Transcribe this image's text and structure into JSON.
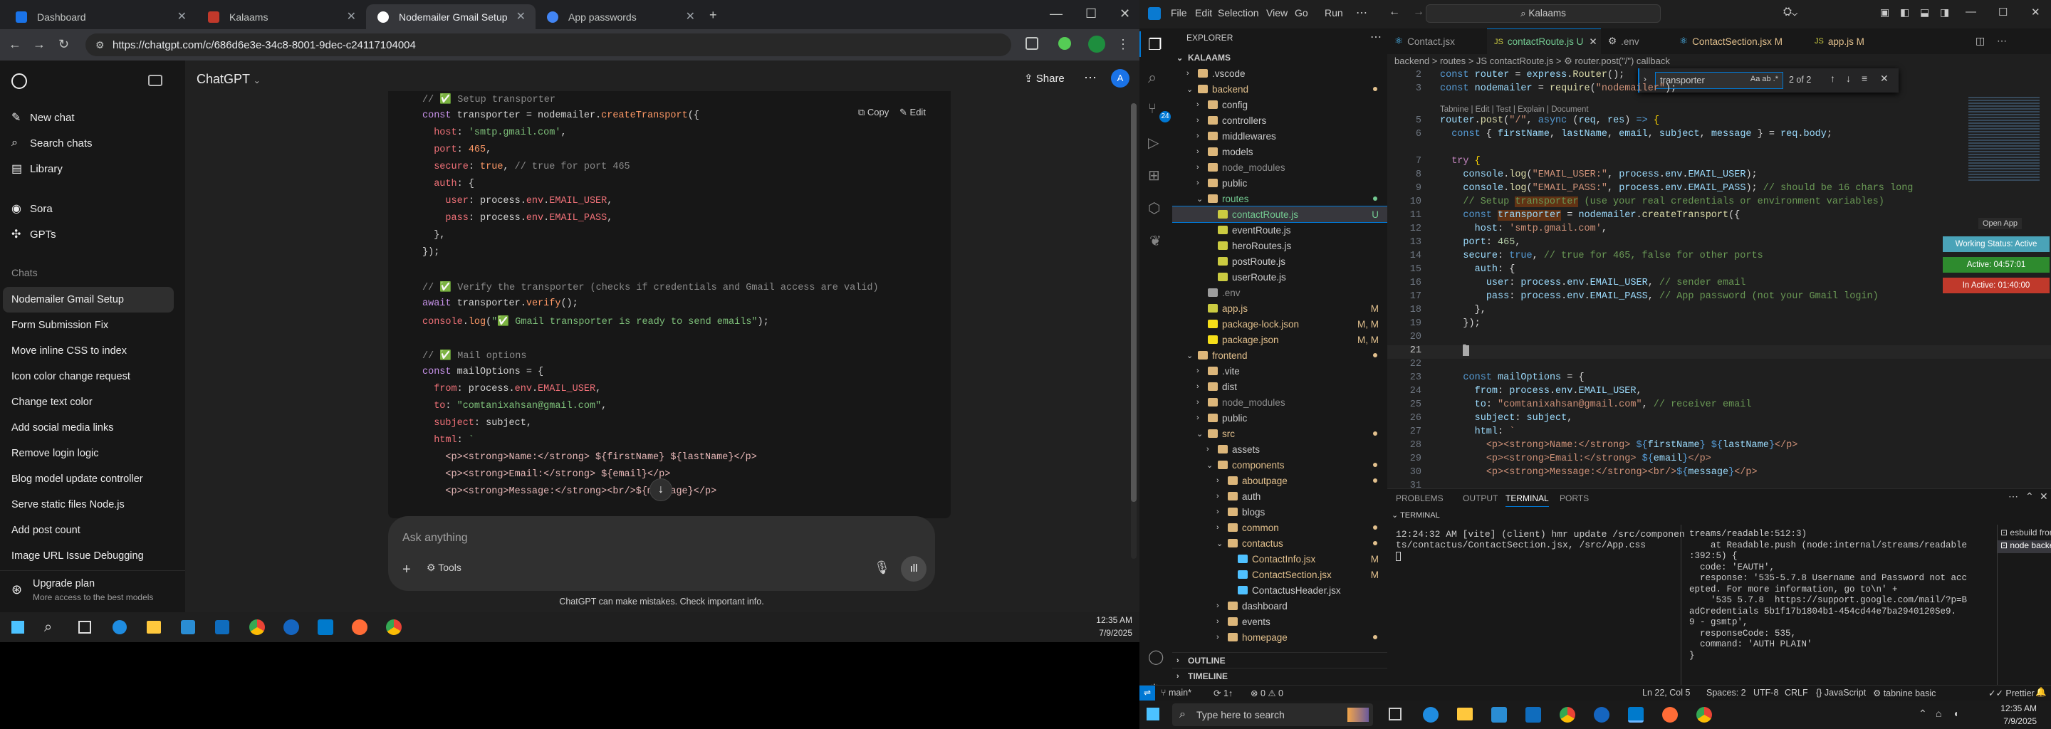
{
  "browser": {
    "tabs": [
      "Dashboard",
      "Kalaams",
      "Nodemailer Gmail Setup",
      "App passwords"
    ],
    "url": "https://chatgpt.com/c/686d6e3e-34c8-8001-9dec-c24117104004"
  },
  "chatgpt": {
    "brand": "ChatGPT",
    "nav": [
      "New chat",
      "Search chats",
      "Library",
      "Sora",
      "GPTs"
    ],
    "chats_heading": "Chats",
    "chats": [
      "Nodemailer Gmail Setup",
      "Form Submission Fix",
      "Move inline CSS to index",
      "Icon color change request",
      "Change text color",
      "Add social media links",
      "Remove login logic",
      "Blog model update controller",
      "Serve static files Node.js",
      "Add post count",
      "Image URL Issue Debugging"
    ],
    "upgrade_title": "Upgrade plan",
    "upgrade_sub": "More access to the best models",
    "share": "Share",
    "avatar": "A",
    "copy": "Copy",
    "edit": "Edit",
    "input_placeholder": "Ask anything",
    "tools": "Tools",
    "disclaimer": "ChatGPT can make mistakes. Check important info.",
    "code_lines": [
      "// ✅ Setup transporter",
      "const transporter = nodemailer.createTransport({",
      "  host: 'smtp.gmail.com',",
      "  port: 465,",
      "  secure: true, // true for port 465",
      "  auth: {",
      "    user: process.env.EMAIL_USER,",
      "    pass: process.env.EMAIL_PASS,",
      "  },",
      "});",
      "",
      "// ✅ Verify the transporter (checks if credentials and Gmail access are valid)",
      "await transporter.verify();",
      "console.log(\"✅ Gmail transporter is ready to send emails\");",
      "",
      "// ✅ Mail options",
      "const mailOptions = {",
      "  from: process.env.EMAIL_USER,",
      "  to: \"comtanixahsan@gmail.com\",",
      "  subject: subject,",
      "  html: `",
      "    <p><strong>Name:</strong> ${firstName} ${lastName}</p>",
      "    <p><strong>Email:</strong> ${email}</p>",
      "    <p><strong>Message:</strong><br/>${message}</p>"
    ]
  },
  "taskbar_left": {
    "time": "12:35 AM",
    "date": "7/9/2025"
  },
  "vscode": {
    "menu": [
      "File",
      "Edit",
      "Selection",
      "View",
      "Go",
      "Run"
    ],
    "search": "Kalaams",
    "explorer_title": "EXPLORER",
    "root": "KALAAMS",
    "tree": [
      {
        "label": ".vscode",
        "depth": 1,
        "type": "folder"
      },
      {
        "label": "backend",
        "depth": 1,
        "type": "folder-open",
        "color": "#e2c08d"
      },
      {
        "label": "config",
        "depth": 2,
        "type": "folder"
      },
      {
        "label": "controllers",
        "depth": 2,
        "type": "folder"
      },
      {
        "label": "middlewares",
        "depth": 2,
        "type": "folder"
      },
      {
        "label": "models",
        "depth": 2,
        "type": "folder"
      },
      {
        "label": "node_modules",
        "depth": 2,
        "type": "folder",
        "color": "#8c8c8c"
      },
      {
        "label": "public",
        "depth": 2,
        "type": "folder"
      },
      {
        "label": "routes",
        "depth": 2,
        "type": "folder-open",
        "color": "#73c991"
      },
      {
        "label": "contactRoute.js",
        "depth": 3,
        "type": "file",
        "status": "U",
        "color": "#73c991",
        "selected": true
      },
      {
        "label": "eventRoute.js",
        "depth": 3,
        "type": "file"
      },
      {
        "label": "heroRoutes.js",
        "depth": 3,
        "type": "file"
      },
      {
        "label": "postRoute.js",
        "depth": 3,
        "type": "file"
      },
      {
        "label": "userRoute.js",
        "depth": 3,
        "type": "file"
      },
      {
        "label": ".env",
        "depth": 2,
        "type": "file",
        "color": "#8c8c8c"
      },
      {
        "label": "app.js",
        "depth": 2,
        "type": "file",
        "status": "M",
        "color": "#e2c08d"
      },
      {
        "label": "package-lock.json",
        "depth": 2,
        "type": "file",
        "status": "M, M",
        "color": "#e2c08d"
      },
      {
        "label": "package.json",
        "depth": 2,
        "type": "file",
        "status": "M, M",
        "color": "#e2c08d"
      },
      {
        "label": "frontend",
        "depth": 1,
        "type": "folder-open",
        "color": "#e2c08d"
      },
      {
        "label": ".vite",
        "depth": 2,
        "type": "folder"
      },
      {
        "label": "dist",
        "depth": 2,
        "type": "folder"
      },
      {
        "label": "node_modules",
        "depth": 2,
        "type": "folder",
        "color": "#8c8c8c"
      },
      {
        "label": "public",
        "depth": 2,
        "type": "folder"
      },
      {
        "label": "src",
        "depth": 2,
        "type": "folder-open",
        "color": "#e2c08d"
      },
      {
        "label": "assets",
        "depth": 3,
        "type": "folder"
      },
      {
        "label": "components",
        "depth": 3,
        "type": "folder-open",
        "color": "#e2c08d"
      },
      {
        "label": "aboutpage",
        "depth": 4,
        "type": "folder",
        "color": "#e2c08d"
      },
      {
        "label": "auth",
        "depth": 4,
        "type": "folder"
      },
      {
        "label": "blogs",
        "depth": 4,
        "type": "folder"
      },
      {
        "label": "common",
        "depth": 4,
        "type": "folder",
        "color": "#e2c08d"
      },
      {
        "label": "contactus",
        "depth": 4,
        "type": "folder-open",
        "color": "#e2c08d"
      },
      {
        "label": "ContactInfo.jsx",
        "depth": 5,
        "type": "file",
        "status": "M",
        "color": "#e2c08d"
      },
      {
        "label": "ContactSection.jsx",
        "depth": 5,
        "type": "file",
        "status": "M",
        "color": "#e2c08d"
      },
      {
        "label": "ContactusHeader.jsx",
        "depth": 5,
        "type": "file"
      },
      {
        "label": "dashboard",
        "depth": 4,
        "type": "folder"
      },
      {
        "label": "events",
        "depth": 4,
        "type": "folder"
      },
      {
        "label": "homepage",
        "depth": 4,
        "type": "folder",
        "color": "#e2c08d"
      }
    ],
    "outline": "OUTLINE",
    "timeline": "TIMELINE",
    "tabs": [
      {
        "label": "Contact.jsx",
        "flag": ""
      },
      {
        "label": "contactRoute.js",
        "flag": "U"
      },
      {
        "label": ".env",
        "flag": ""
      },
      {
        "label": "ContactSection.jsx",
        "flag": "M"
      },
      {
        "label": "app.js",
        "flag": "M"
      }
    ],
    "breadcrumb": "backend > routes > JS contactRoute.js > ⚙ router.post(\"/\") callback",
    "find_text": "transporter",
    "find_count": "2 of 2",
    "codelens": "Tabnine | Edit | Test | Explain | Document",
    "line_numbers": [
      "2",
      "3",
      "",
      "5",
      "6",
      "",
      "7",
      "8",
      "9",
      "10",
      "11",
      "12",
      "13",
      "14",
      "15",
      "16",
      "17",
      "18",
      "19",
      "20",
      "21",
      "22",
      "23",
      "24",
      "25",
      "26",
      "27",
      "28",
      "29",
      "30",
      "31"
    ],
    "open_app": "Open App",
    "status_badges": [
      "Working Status: Active",
      "Active: 04:57:01",
      "In Active: 01:40:00"
    ],
    "panel_tabs": [
      "PROBLEMS",
      "OUTPUT",
      "TERMINAL",
      "PORTS"
    ],
    "terminal_title": "TERMINAL",
    "term_left": [
      "12:24:32 AM [vite] (client) hmr update /src/componen",
      "ts/contactus/ContactSection.jsx, /src/App.css"
    ],
    "term_right": [
      "treams/readable:512:3)",
      "    at Readable.push (node:internal/streams/readable",
      ":392:5) {",
      "  code: 'EAUTH',",
      "  response: '535-5.7.8 Username and Password not acc",
      "epted. For more information, go to\\n' +",
      "    '535 5.7.8  https://support.google.com/mail/?p=B",
      "adCredentials 5b1f17b1804b1-454cd44e7ba2940120Se9.",
      "9 - gsmtp',",
      "  responseCode: 535,",
      "  command: 'AUTH PLAIN'",
      "}"
    ],
    "term_list": [
      "esbuild frontend",
      "node backend"
    ],
    "statusbar_left": [
      "main*",
      "1↑",
      "⊗ 0 ⚠ 0"
    ],
    "statusbar_right": [
      "Ln 22, Col 5",
      "Spaces: 2",
      "UTF-8",
      "CRLF",
      "{} JavaScript",
      "tabnine basic",
      "Prettier"
    ],
    "search_placeholder": "Type here to search",
    "time": "12:35 AM",
    "date": "7/9/2025"
  }
}
